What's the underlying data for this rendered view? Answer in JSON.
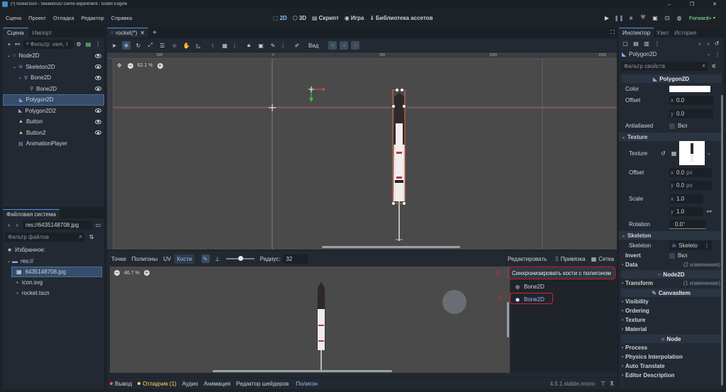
{
  "titlebar": {
    "title": "(*) rocket.tscn - Skeleton2D Demo experiment - Godot Engine"
  },
  "menu": [
    "Сцена",
    "Проект",
    "Отладка",
    "Редактор",
    "Справка"
  ],
  "workspaces": [
    "2D",
    "3D",
    "Скрипт",
    "Игра",
    "Библиотека ассетов"
  ],
  "renderer": "Forward+",
  "scene_dock": {
    "tabs": [
      "Сцена",
      "Импорт"
    ],
    "filter_placeholder": "Фильтр: имя, т",
    "nodes": [
      {
        "name": "Node2D",
        "icon": "node2d-icon",
        "color": "#8da5f3"
      },
      {
        "name": "Skeleton2D",
        "icon": "skeleton-icon",
        "color": "#8da5f3"
      },
      {
        "name": "Bone2D",
        "icon": "bone-icon",
        "color": "#8da5f3"
      },
      {
        "name": "Bone2D",
        "icon": "bone-icon",
        "color": "#8da5f3"
      },
      {
        "name": "Polygon2D",
        "icon": "polygon-icon",
        "color": "#8da5f3"
      },
      {
        "name": "Polygon2D2",
        "icon": "polygon-icon",
        "color": "#8da5f3"
      },
      {
        "name": "Button",
        "icon": "button-icon",
        "color": "#8eef97"
      },
      {
        "name": "Button2",
        "icon": "button-icon",
        "color": "#8eef97"
      },
      {
        "name": "AnimationPlayer",
        "icon": "animation-player-icon",
        "color": "#c38ef1"
      }
    ]
  },
  "filesystem": {
    "title": "Файловая система",
    "path": "res://6435148708.jpg",
    "filter_placeholder": "Фильтр файлов",
    "favorites": "Избранное:",
    "root": "res://",
    "files": [
      "6435148708.jpg",
      "icon.svg",
      "rocket.tscn"
    ]
  },
  "editor_tabs": [
    "rocket(*)"
  ],
  "toolbar": {
    "view_label": "Вид"
  },
  "viewport": {
    "zoom": "62.1 %",
    "ruler": [
      "500",
      "0",
      "500",
      "1000",
      "1500"
    ]
  },
  "polygon_editor": {
    "tabs": [
      "Точки",
      "Полигоны",
      "UV",
      "Кости"
    ],
    "radius_label": "Радиус:",
    "radius_value": "32",
    "edit_label": "Редактировать",
    "snap_label": "Привязка",
    "grid_label": "Сетка",
    "zoom": "46.7 %",
    "sync_button": "Синхронизировать кости с полигоном",
    "bones": [
      "Bone2D",
      "Bone2D"
    ],
    "annotations": [
      "1",
      "2"
    ]
  },
  "bottom_panel": {
    "tabs": [
      "Вывод",
      "Отладчик (1)",
      "Аудио",
      "Анимация",
      "Редактор шейдеров",
      "Полигон"
    ],
    "version": "4.5.1.stable.mono"
  },
  "inspector": {
    "tabs": [
      "Инспектор",
      "Узел",
      "История"
    ],
    "node_type": "Polygon2D",
    "filter_placeholder": "Фильтр свойств",
    "class_header": "Polygon2D",
    "color_label": "Color",
    "color_value": "#ffffff",
    "offset_label": "Offset",
    "offset_x": "0.0",
    "offset_y": "0.0",
    "antialiased_label": "Antialiased",
    "antialiased_value": "Вкл",
    "texture_section": "Texture",
    "texture_label": "Texture",
    "tex_offset_label": "Offset",
    "tex_offset_x": "0.0",
    "tex_offset_y": "0.0",
    "unit": "px",
    "scale_label": "Scale",
    "scale_x": "1.0",
    "scale_y": "1.0",
    "rotation_label": "Rotation",
    "rotation_value": "0.0",
    "rotation_unit": "°",
    "skeleton_section": "Skeleton",
    "skeleton_label": "Skeleton",
    "skeleton_value": "Skeleto",
    "invert_label": "Invert",
    "invert_value": "Вкл",
    "data_label": "Data",
    "data_changes": "(2 изменения)",
    "node2d_header": "Node2D",
    "transform_label": "Transform",
    "transform_changes": "(1 изменение)",
    "canvasitem_header": "CanvasItem",
    "canvas_sections": [
      "Visibility",
      "Ordering",
      "Texture",
      "Material"
    ],
    "node_header": "Node",
    "node_sections": [
      "Process",
      "Physics Interpolation",
      "Auto Translate",
      "Editor Description"
    ],
    "axis_x": "x",
    "axis_y": "y"
  },
  "colors": {
    "accent": "#4d92e8",
    "highlight_red": "#e0202a",
    "bg": "#1d2229",
    "panel": "#232932"
  }
}
